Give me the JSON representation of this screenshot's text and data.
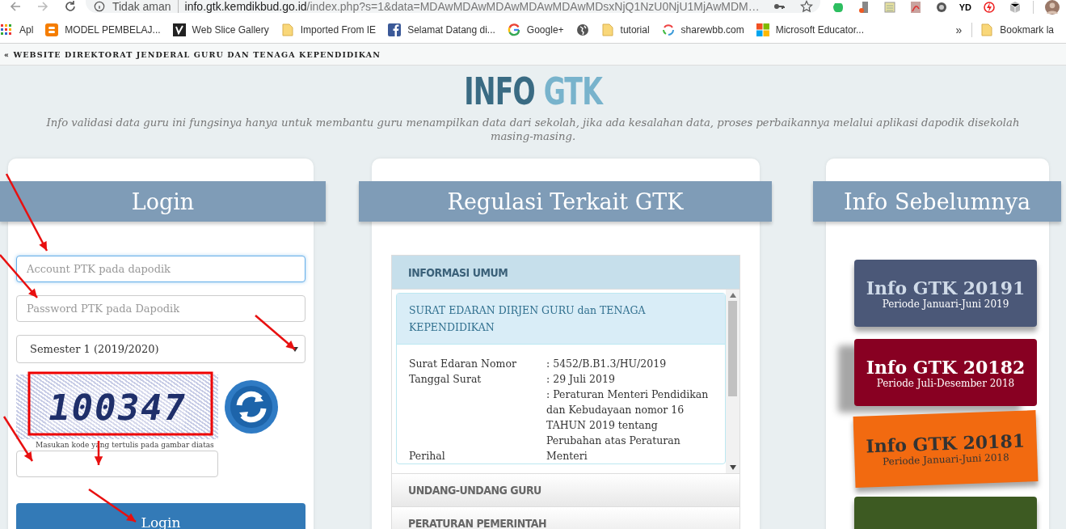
{
  "browser": {
    "security": "Tidak aman",
    "url_host": "info.gtk.kemdikbud.go.id",
    "url_path": "/index.php?s=1&data=MDAwMDAwMDAwMDAwMDAwMDsxNjQ1NzU0NjU1MjAwMDM…",
    "extension_text": "YD"
  },
  "bookmarks": [
    {
      "label": "Apl",
      "kind": "apps"
    },
    {
      "label": "MODEL PEMBELAJ...",
      "kind": "blogger"
    },
    {
      "label": "Web Slice Gallery",
      "kind": "slice"
    },
    {
      "label": "Imported From IE",
      "kind": "folder"
    },
    {
      "label": "Selamat Datang di...",
      "kind": "facebook"
    },
    {
      "label": "Google+",
      "kind": "google"
    },
    {
      "kind": "globe"
    },
    {
      "label": "tutorial",
      "kind": "folder"
    },
    {
      "label": "sharewbb.com",
      "kind": "swirl"
    },
    {
      "label": "Microsoft Educator...",
      "kind": "windows"
    }
  ],
  "bookmarks_more": "»",
  "other_bookmarks": "Bookmark la",
  "site": {
    "top_link": "« WEBSITE DIREKTORAT JENDERAL GURU DAN TENAGA KEPENDIDIKAN",
    "logo_first": "INFO",
    "logo_second": "GTK",
    "tagline": "Info validasi data guru ini fungsinya hanya untuk membantu guru menampilkan data dari sekolah, jika ada kesalahan data, proses perbaikannya melalui aplikasi dapodik disekolah masing-masing."
  },
  "login": {
    "title": "Login",
    "account": {
      "placeholder": "Account PTK pada dapodik",
      "focused": true
    },
    "password": {
      "placeholder": "Password PTK pada Dapodik",
      "focused": false
    },
    "semester": "Semester 1 (2019/2020)",
    "captcha_code": "100347",
    "captcha_hint": "Masukan kode yang tertulis pada gambar diatas",
    "button": "Login"
  },
  "regulasi": {
    "title": "Regulasi Terkait GTK",
    "sections": [
      {
        "title": "INFORMASI UMUM",
        "expanded": true,
        "notice": {
          "heading": "SURAT EDARAN DIRJEN GURU dan TENAGA KEPENDIDIKAN",
          "rows": [
            {
              "label": "Surat Edaran Nomor",
              "value": ": 5452/B.B1.3/HU/2019"
            },
            {
              "label": "Tanggal Surat",
              "value": ": 29 Juli 2019"
            },
            {
              "label": "Perihal",
              "value": ": Peraturan Menteri Pendidikan dan Kebudayaan nomor 16 TAHUN 2019 tentang Perubahan atas Peraturan Menteri"
            }
          ]
        }
      },
      {
        "title": "UNDANG-UNDANG GURU",
        "expanded": false
      },
      {
        "title": "PERATURAN PEMERINTAH",
        "expanded": false
      }
    ]
  },
  "previous": {
    "title": "Info Sebelumnya",
    "items": [
      {
        "title": "Info GTK 20191",
        "period": "Periode Januari-Juni 2019",
        "color": "#4b5878",
        "kind": "flat"
      },
      {
        "title": "Info GTK 20182",
        "period": "Periode Juli-Desember 2018",
        "color": "#880022",
        "kind": "curl"
      },
      {
        "title": "Info GTK 20181",
        "period": "Periode Januari-Juni 2018",
        "color": "#f26a10",
        "kind": "tilted"
      },
      {
        "color": "#3d5a22",
        "kind": "flat"
      }
    ]
  }
}
